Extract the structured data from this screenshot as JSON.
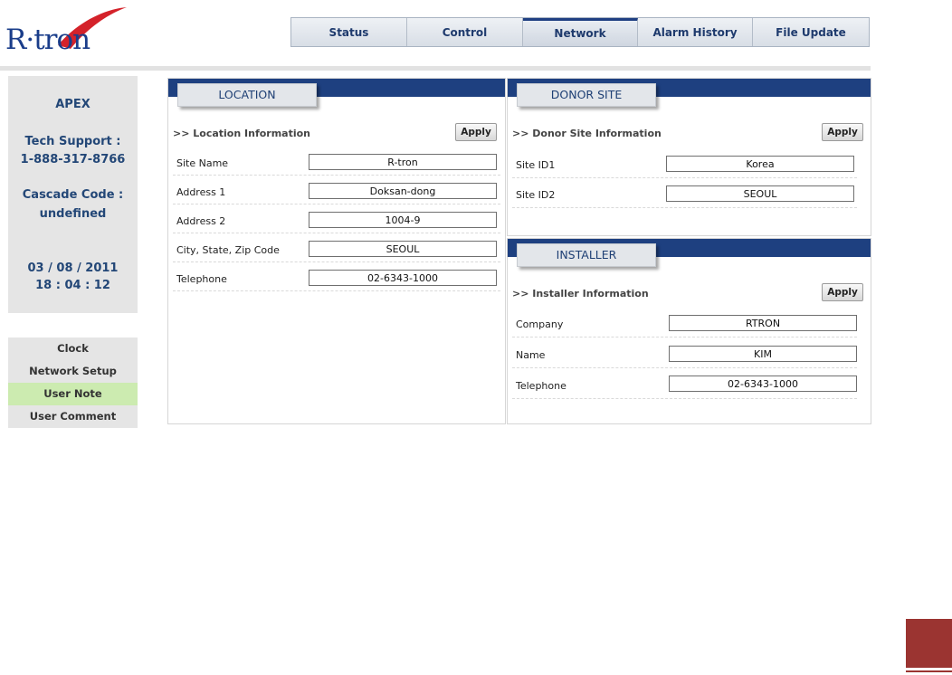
{
  "logo": {
    "text": "R·tron"
  },
  "tabs": [
    {
      "label": "Status"
    },
    {
      "label": "Control"
    },
    {
      "label": "Network"
    },
    {
      "label": "Alarm History"
    },
    {
      "label": "File Update"
    }
  ],
  "active_tab": "Network",
  "sidebar": {
    "device": "APEX",
    "support_label": "Tech Support :",
    "support_phone": "1-888-317-8766",
    "cascade_label": "Cascade Code :",
    "cascade_value": "undefined",
    "date": "03 / 08 / 2011",
    "time": "18 : 04 : 12"
  },
  "menu": [
    {
      "label": "Clock"
    },
    {
      "label": "Network Setup"
    },
    {
      "label": "User Note"
    },
    {
      "label": "User Comment"
    }
  ],
  "active_menu": "User Note",
  "location": {
    "tab": "LOCATION",
    "section": ">> Location Information",
    "apply": "Apply",
    "rows": [
      {
        "label": "Site Name",
        "value": "R-tron"
      },
      {
        "label": "Address 1",
        "value": "Doksan-dong"
      },
      {
        "label": "Address 2",
        "value": "1004-9"
      },
      {
        "label": "City, State, Zip Code",
        "value": "SEOUL"
      },
      {
        "label": "Telephone",
        "value": "02-6343-1000"
      }
    ]
  },
  "donor": {
    "tab": "DONOR SITE",
    "section": ">> Donor Site Information",
    "apply": "Apply",
    "rows": [
      {
        "label": "Site ID1",
        "value": "Korea"
      },
      {
        "label": "Site ID2",
        "value": "SEOUL"
      }
    ]
  },
  "installer": {
    "tab": "INSTALLER",
    "section": ">> Installer Information",
    "apply": "Apply",
    "rows": [
      {
        "label": "Company",
        "value": "RTRON"
      },
      {
        "label": "Name",
        "value": "KIM"
      },
      {
        "label": "Telephone",
        "value": "02-6343-1000"
      }
    ]
  },
  "colors": {
    "brand_blue": "#1e4080",
    "brand_red": "#9b3431",
    "active_menu_bg": "#ccebb0"
  }
}
